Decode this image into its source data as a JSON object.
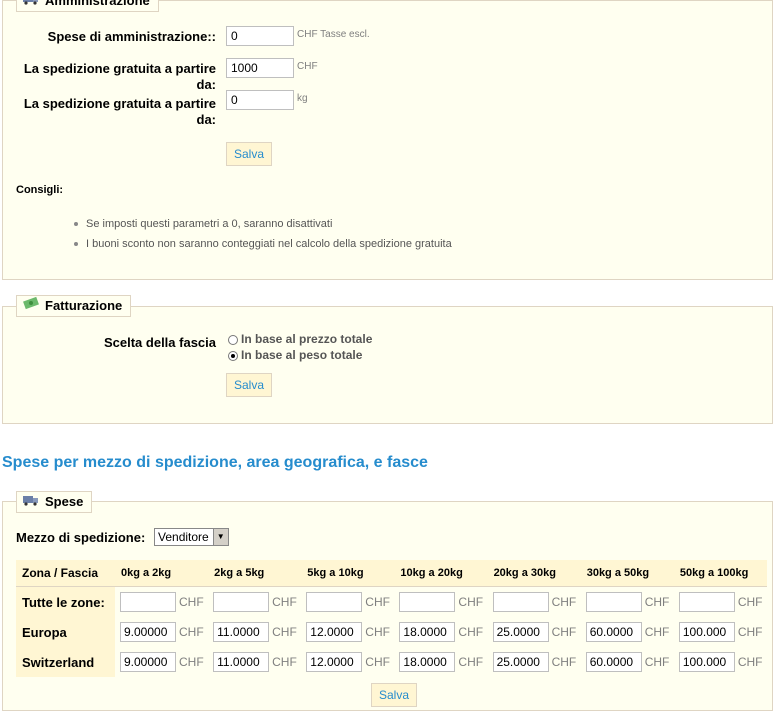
{
  "admin": {
    "legend": "Amministrazione",
    "handling_label": "Spese di amministrazione::",
    "handling_value": "0",
    "handling_hint": "CHF Tasse escl.",
    "free_price_label": "La spedizione gratuita a partire da:",
    "free_price_value": "1000",
    "free_price_hint": "CHF",
    "free_weight_label": "La spedizione gratuita a partire da:",
    "free_weight_value": "0",
    "free_weight_hint": "kg",
    "save_label": "Salva",
    "tips_title": "Consigli:",
    "tips": [
      "Se imposti questi parametri a 0, saranno disattivati",
      "I buoni sconto non saranno conteggiati nel calcolo della spedizione gratuita"
    ]
  },
  "billing": {
    "legend": "Fatturazione",
    "range_label": "Scelta della fascia",
    "options": [
      "In base al prezzo totale",
      "In base al peso totale"
    ],
    "selected_index": 1,
    "save_label": "Salva"
  },
  "fees": {
    "heading": "Spese per mezzo di spedizione, area geografica, e fasce",
    "legend": "Spese",
    "carrier_label": "Mezzo di spedizione:",
    "carrier_value": "Venditore",
    "zone_header": "Zona / Fascia",
    "ranges": [
      "0kg a 2kg",
      "2kg a 5kg",
      "5kg a 10kg",
      "10kg a 20kg",
      "20kg a 30kg",
      "30kg a 50kg",
      "50kg a 100kg"
    ],
    "currency": "CHF",
    "rows": [
      {
        "zone": "Tutte le zone:",
        "values": [
          "",
          "",
          "",
          "",
          "",
          "",
          ""
        ]
      },
      {
        "zone": "Europa",
        "values": [
          "9.00000",
          "11.0000",
          "12.0000",
          "18.0000",
          "25.0000",
          "60.0000",
          "100.000"
        ]
      },
      {
        "zone": "Switzerland",
        "values": [
          "9.00000",
          "11.0000",
          "12.0000",
          "18.0000",
          "25.0000",
          "60.0000",
          "100.000"
        ]
      }
    ],
    "save_label": "Salva"
  },
  "colors": {
    "accent": "#268ccd",
    "panel": "#fffff0",
    "header": "#fff6d3",
    "border": "#dfd5c3"
  }
}
